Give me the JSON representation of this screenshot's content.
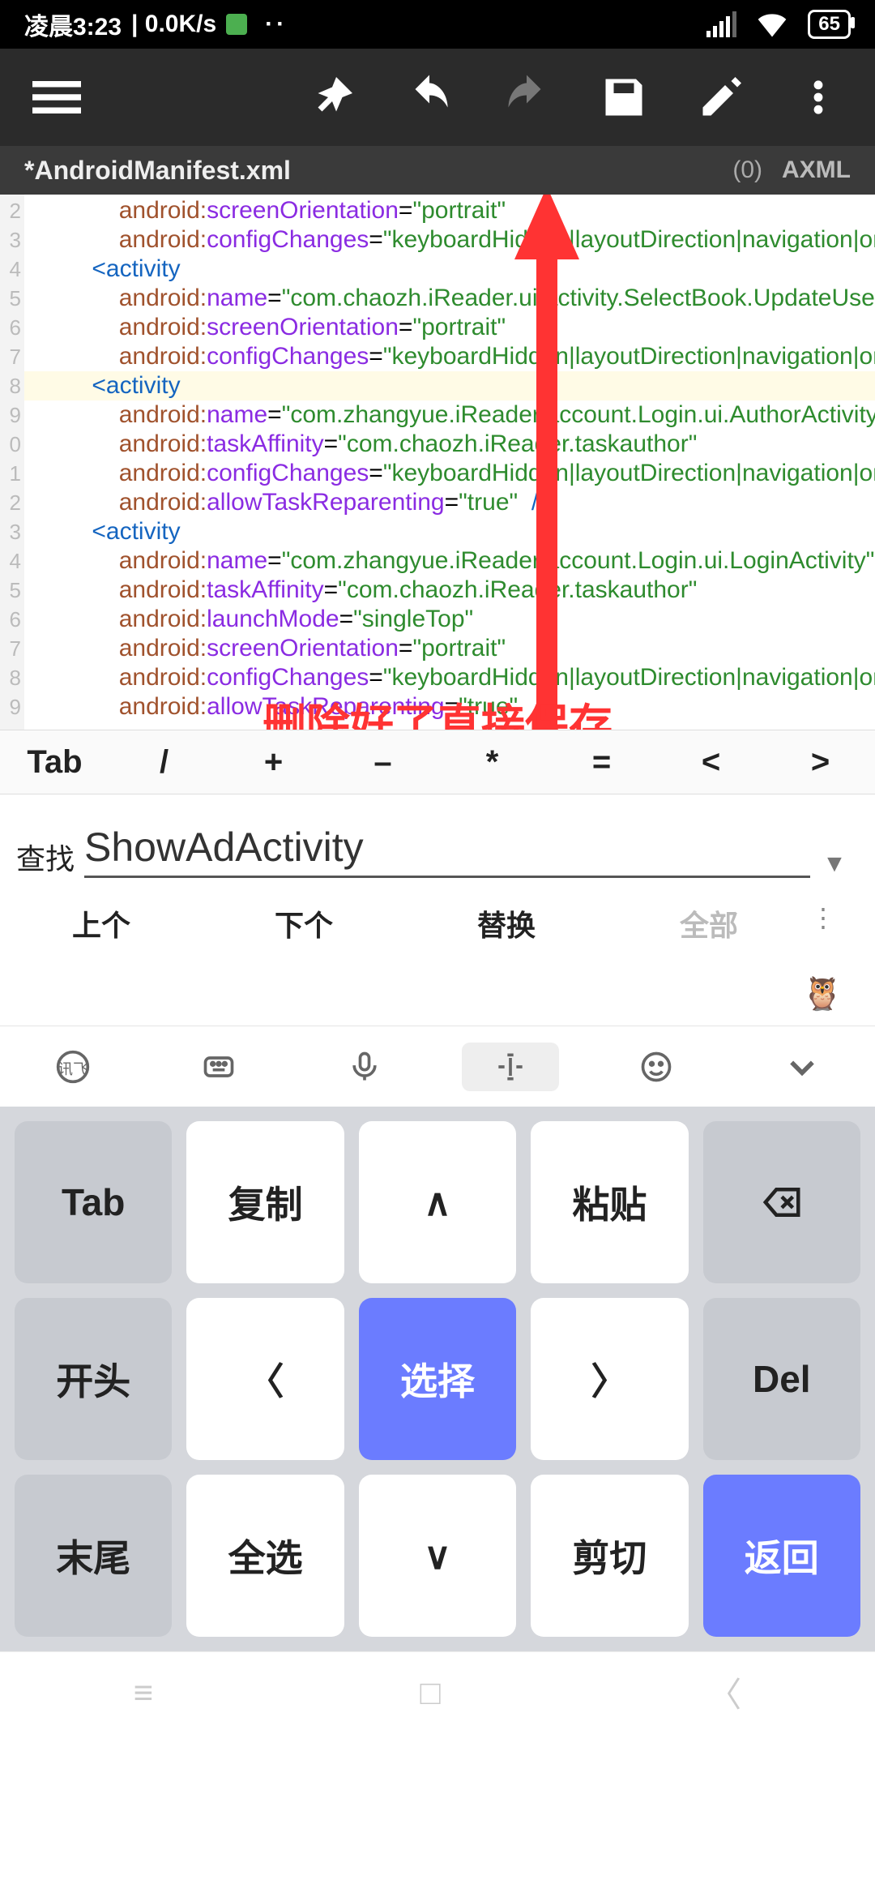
{
  "statusbar": {
    "time": "凌晨3:23",
    "netspeed": "| 0.0K/s",
    "battery": "65"
  },
  "tab": {
    "title": "*AndroidManifest.xml",
    "count": "(0)",
    "format": "AXML"
  },
  "gutter": [
    "2",
    "3",
    "4",
    "5",
    "6",
    "7",
    "8",
    "9",
    "0",
    "1",
    "2",
    "3",
    "4",
    "5",
    "6",
    "7",
    "8",
    "9"
  ],
  "code": [
    "              <span class='a'>android:</span><span class='k'>screenOrientation</span>=<span class='v'>\"portrait\"</span>",
    "              <span class='a'>android:</span><span class='k'>configChanges</span>=<span class='v'>\"keyboardHidden|layoutDirection|navigation|orien</span>",
    "          <span class='t'>&lt;activity</span>",
    "              <span class='a'>android:</span><span class='k'>name</span>=<span class='v'>\"com.chaozh.iReader.ui.activity.SelectBook.UpdateUserGu</span>",
    "              <span class='a'>android:</span><span class='k'>screenOrientation</span>=<span class='v'>\"portrait\"</span>",
    "              <span class='a'>android:</span><span class='k'>configChanges</span>=<span class='v'>\"keyboardHidden|layoutDirection|navigation|orien</span>",
    "          <span class='t'>&lt;activity</span>",
    "              <span class='a'>android:</span><span class='k'>name</span>=<span class='v'>\"com.zhangyue.iReader.account.Login.ui.AuthorActivity\"</span>",
    "              <span class='a'>android:</span><span class='k'>taskAffinity</span>=<span class='v'>\"com.chaozh.iReader.taskauthor\"</span>",
    "              <span class='a'>android:</span><span class='k'>configChanges</span>=<span class='v'>\"keyboardHidden|layoutDirection|navigation|orien</span>",
    "              <span class='a'>android:</span><span class='k'>allowTaskReparenting</span>=<span class='v'>\"true\"</span>  <span class='t'>/&gt;</span>",
    "          <span class='t'>&lt;activity</span>",
    "              <span class='a'>android:</span><span class='k'>name</span>=<span class='v'>\"com.zhangyue.iReader.account.Login.ui.LoginActivity\"</span>",
    "              <span class='a'>android:</span><span class='k'>taskAffinity</span>=<span class='v'>\"com.chaozh.iReader.taskauthor\"</span>",
    "              <span class='a'>android:</span><span class='k'>launchMode</span>=<span class='v'>\"singleTop\"</span>",
    "              <span class='a'>android:</span><span class='k'>screenOrientation</span>=<span class='v'>\"portrait\"</span>",
    "              <span class='a'>android:</span><span class='k'>configChanges</span>=<span class='v'>\"keyboardHidden|layoutDirection|navigation|orien</span>",
    "              <span class='a'>android:</span><span class='k'>allowTaskReparenting</span>=<span class='v'>\"true\"</span>"
  ],
  "symbols": {
    "tab": "Tab",
    "slash": "/",
    "plus": "+",
    "minus": "–",
    "star": "*",
    "eq": "=",
    "lt": "<",
    "gt": ">"
  },
  "search": {
    "label": "查找",
    "value": "ShowAdActivity"
  },
  "actions": {
    "prev": "上个",
    "next": "下个",
    "replace": "替换",
    "all": "全部"
  },
  "overlay": "删除好了直接保存",
  "keys": {
    "r1": [
      "Tab",
      "复制",
      "∧",
      "粘贴",
      "⌫"
    ],
    "r2": [
      "开头",
      "〈",
      "选择",
      "〉",
      "Del"
    ],
    "r3": [
      "末尾",
      "全选",
      "∨",
      "剪切",
      "返回"
    ]
  }
}
